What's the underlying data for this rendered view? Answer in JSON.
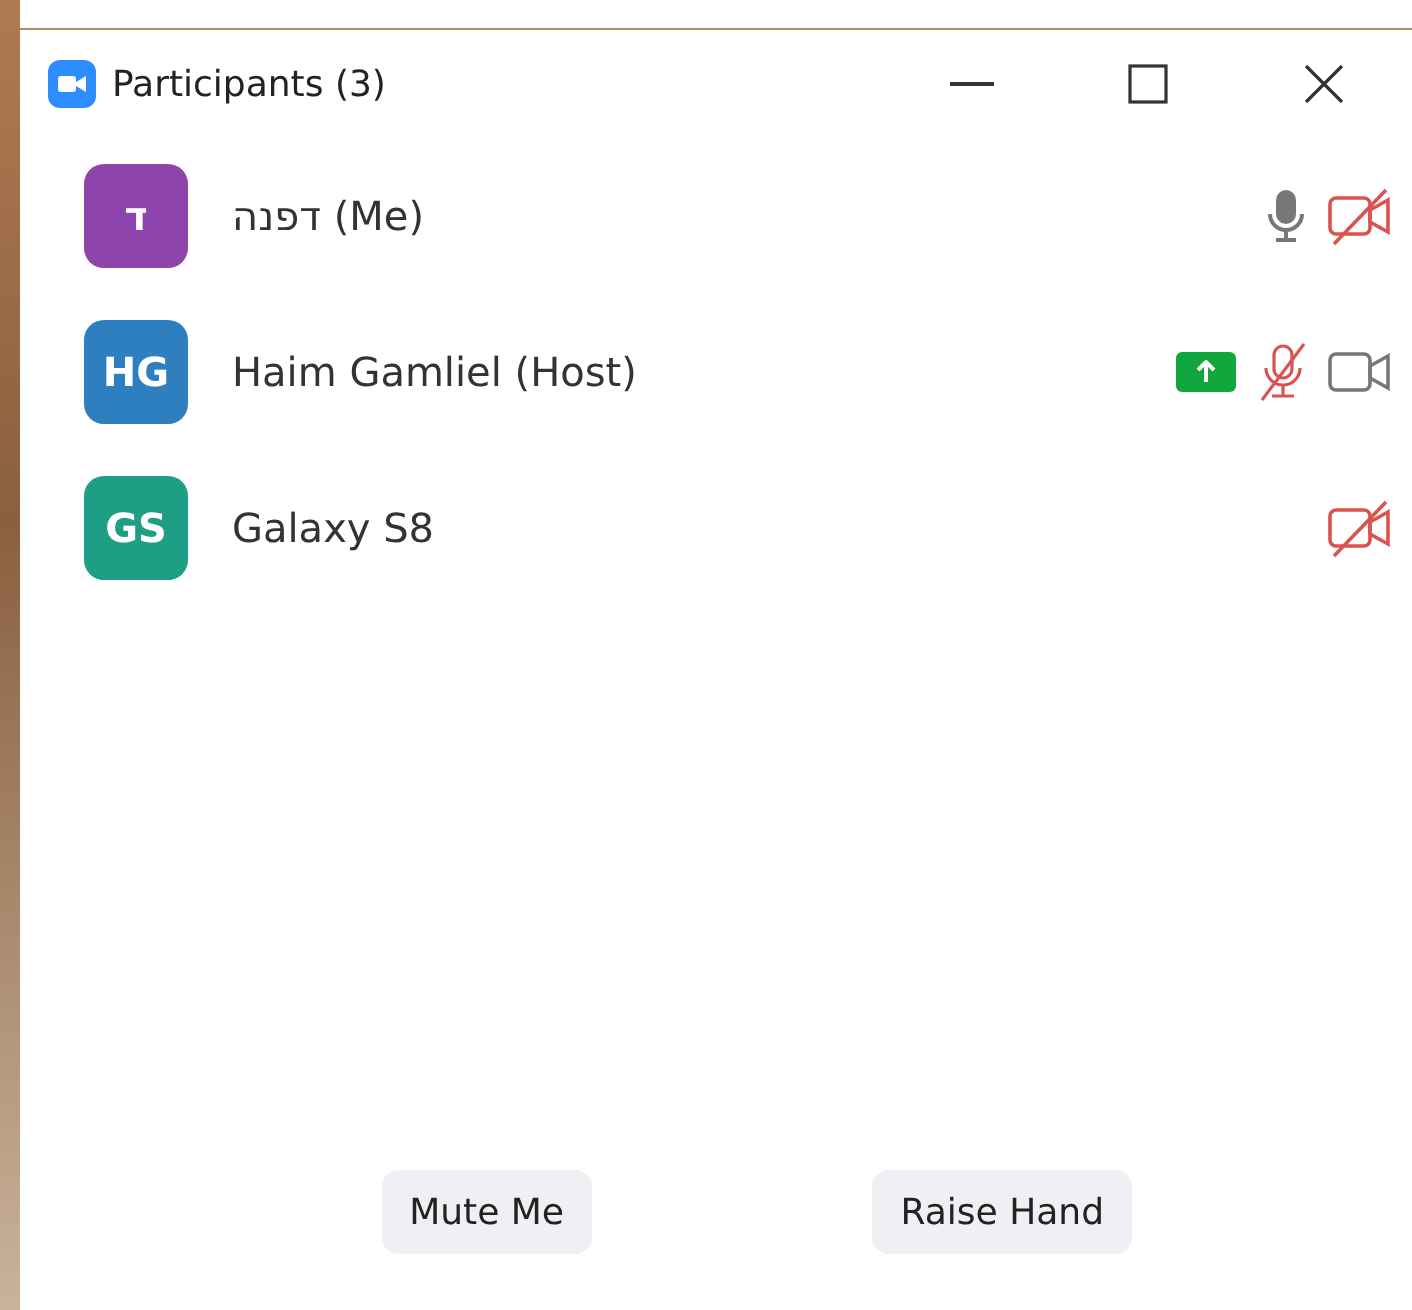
{
  "window": {
    "title": "Participants (3)"
  },
  "participants": [
    {
      "initials": "ד",
      "name": "דפנה (Me)",
      "color": "#8e44ad",
      "sharing": false,
      "muted": false,
      "video_on": false
    },
    {
      "initials": "HG",
      "name": "Haim Gamliel (Host)",
      "color": "#2e7fbf",
      "sharing": true,
      "muted": true,
      "video_on": true
    },
    {
      "initials": "GS",
      "name": "Galaxy S8",
      "color": "#1f9e86",
      "sharing": false,
      "video_on": false
    }
  ],
  "buttons": [
    "Mute Me",
    "Raise Hand"
  ]
}
